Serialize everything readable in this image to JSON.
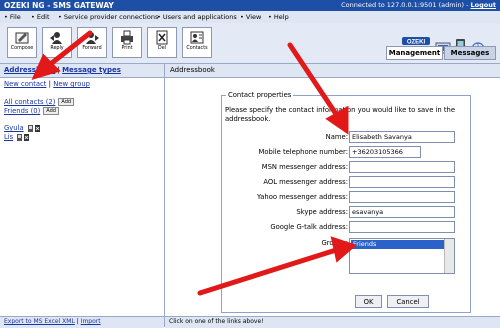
{
  "title_bar": {
    "app_title": "OZEKI NG - SMS GATEWAY",
    "connection": "Connected to 127.0.0.1:9501 (admin) - ",
    "logout": "Logout"
  },
  "menu": [
    "• File",
    "• Edit",
    "• Service provider connections",
    "• Users and applications",
    "• View",
    "• Help"
  ],
  "toolbar": {
    "buttons": [
      {
        "label": "Compose",
        "icon": "compose-icon"
      },
      {
        "label": "Reply",
        "icon": "reply-icon"
      },
      {
        "label": "Forward",
        "icon": "forward-icon"
      },
      {
        "label": "Print",
        "icon": "print-icon"
      },
      {
        "label": "Del",
        "icon": "delete-icon"
      },
      {
        "label": "Contacts",
        "icon": "contacts-icon"
      }
    ],
    "logo_text": "OZEKI",
    "tabs": [
      "Management",
      "Messages"
    ]
  },
  "left_panel": {
    "heading_addressbook": "Addressbook",
    "separator": "|",
    "heading_message_types": "Message types",
    "new_contact": "New contact",
    "new_group": "New group",
    "groups": [
      {
        "label": "All contacts (2)",
        "badge": "Add"
      },
      {
        "label": "Friends (0)",
        "badge": "Add"
      }
    ],
    "contacts": [
      "Gyula",
      "Lis"
    ],
    "footer_export": "Export to MS Excel XML",
    "footer_import": "Import"
  },
  "right_panel": {
    "heading": "Addressbook",
    "legend": "Contact properties",
    "intro": "Please specify the contact information you would like to save in the addressbook.",
    "fields": [
      {
        "label": "Name:",
        "value": "Elisabeth Savanya"
      },
      {
        "label": "Mobile telephone number:",
        "value": "+36203105366"
      },
      {
        "label": "MSN messenger address:",
        "value": ""
      },
      {
        "label": "AOL messenger address:",
        "value": ""
      },
      {
        "label": "Yahoo messenger address:",
        "value": ""
      },
      {
        "label": "Skype address:",
        "value": "esavanya"
      },
      {
        "label": "Google G-talk address:",
        "value": ""
      }
    ],
    "groups_label": "Groups:",
    "groups_selected": "Friends",
    "ok": "OK",
    "cancel": "Cancel",
    "footer": "Click on one of the links above!"
  },
  "colors": {
    "title_bar": "#1e4fa6",
    "link": "#1a35a8",
    "selection": "#2a62c9",
    "arrow": "#e11919",
    "panel_header": "#dfe6f3"
  }
}
